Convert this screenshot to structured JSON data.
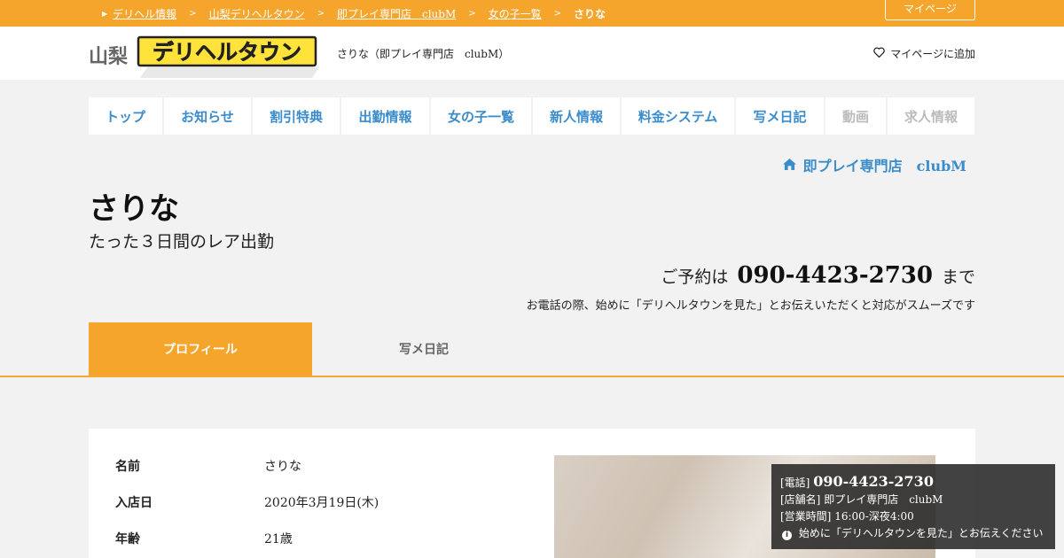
{
  "breadcrumb": {
    "items": [
      "デリヘル情報",
      "山梨デリヘルタウン",
      "即プレイ専門店　clubM",
      "女の子一覧"
    ],
    "current": "さりな",
    "separator": ">"
  },
  "mypage_button": "マイページ",
  "header": {
    "region": "山梨",
    "logo_text": "デリヘルタウン",
    "shop_title": "さりな（即プレイ専門店　clubM）",
    "add_mypage": "マイページに追加"
  },
  "nav": [
    {
      "label": "トップ",
      "enabled": true
    },
    {
      "label": "お知らせ",
      "enabled": true
    },
    {
      "label": "割引特典",
      "enabled": true
    },
    {
      "label": "出勤情報",
      "enabled": true
    },
    {
      "label": "女の子一覧",
      "enabled": true
    },
    {
      "label": "新人情報",
      "enabled": true
    },
    {
      "label": "料金システム",
      "enabled": true
    },
    {
      "label": "写メ日記",
      "enabled": true
    },
    {
      "label": "動画",
      "enabled": false
    },
    {
      "label": "求人情報",
      "enabled": false
    }
  ],
  "shop_link": "即プレイ専門店　clubM",
  "girl": {
    "name": "さりな",
    "catch": "たった３日間のレア出勤"
  },
  "reserve": {
    "prefix": "ご予約は",
    "tel": "090-4423-2730",
    "suffix": "まで",
    "notice": "お電話の際、始めに「デリヘルタウンを見た」とお伝えいただくと対応がスムーズです"
  },
  "tabs": {
    "active": "プロフィール",
    "inactive": "写メ日記"
  },
  "profile": {
    "rows": [
      {
        "label": "名前",
        "value": "さりな"
      },
      {
        "label": "入店日",
        "value": "2020年3月19日(木)"
      },
      {
        "label": "年齢",
        "value": "21歳"
      }
    ]
  },
  "infobox": {
    "tel_label": "[電話]",
    "tel": "090-4423-2730",
    "shop_label": "[店舗名]",
    "shop": "即プレイ専門店　clubM",
    "hours_label": "[営業時間]",
    "hours": "16:00-深夜4:00",
    "note": "始めに「デリヘルタウンを見た」とお伝えください"
  },
  "colors": {
    "accent": "#f6a52c",
    "link": "#3a8ccb",
    "disabled": "#bbbbbb"
  },
  "icons": [
    "heart-outline-icon",
    "home-icon",
    "info-circle-icon",
    "triangle-right-icon"
  ]
}
